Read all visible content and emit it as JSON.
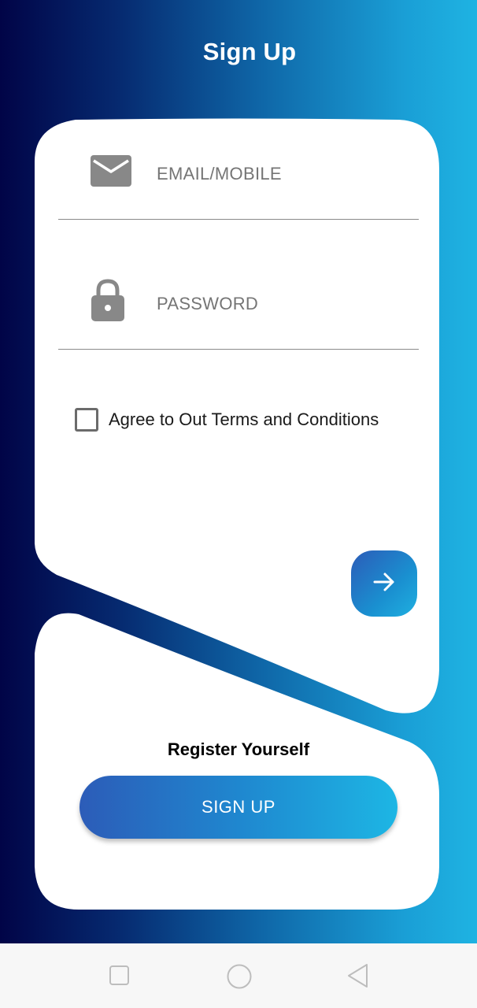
{
  "header": {
    "title": "Sign Up"
  },
  "login_form": {
    "email": {
      "placeholder": "EMAIL/MOBILE",
      "icon": "envelope-icon"
    },
    "password": {
      "placeholder": "PASSWORD",
      "icon": "lock-icon"
    },
    "terms": {
      "label": "Agree to Out Terms and Conditions",
      "checked": false
    },
    "next_button": {
      "icon": "arrow-right-icon"
    }
  },
  "register": {
    "label": "Register Yourself",
    "signup_button_label": "SIGN UP"
  },
  "navbar": {
    "items": [
      "recent-apps-square-icon",
      "home-circle-icon",
      "back-triangle-icon"
    ]
  },
  "colors": {
    "gradient_dark": "#010447",
    "gradient_light": "#1fb3e2",
    "button_start": "#2c5cb8",
    "button_end": "#1db6e4"
  }
}
